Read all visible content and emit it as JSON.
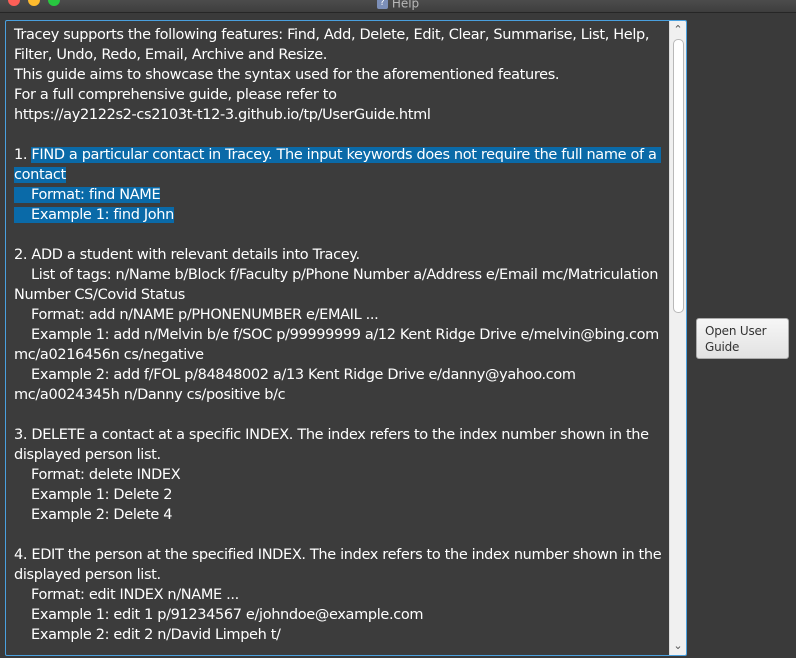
{
  "window": {
    "title": "Help",
    "app_icon": "?"
  },
  "guide": {
    "intro": "Tracey supports the following features: Find, Add, Delete, Edit, Clear, Summarise, List, Help, Filter, Undo, Redo, Email, Archive and Resize.\nThis guide aims to showcase the syntax used for the aforementioned features.\nFor a full comprehensive guide, please refer to\nhttps://ay2122s2-cs2103t-t12-3.github.io/tp/UserGuide.html\n\n1. ",
    "selected": "FIND a particular contact in Tracey. The input keywords does not require the full name of a contact\n    Format: find NAME\n    Example 1: find John",
    "rest": "\n\n2. ADD a student with relevant details into Tracey.\n    List of tags: n/Name b/Block f/Faculty p/Phone Number a/Address e/Email mc/Matriculation Number CS/Covid Status\n    Format: add n/NAME p/PHONENUMBER e/EMAIL ...\n    Example 1: add n/Melvin b/e f/SOC p/99999999 a/12 Kent Ridge Drive e/melvin@bing.com mc/a0216456n cs/negative\n    Example 2: add f/FOL p/84848002 a/13 Kent Ridge Drive e/danny@yahoo.com mc/a0024345h n/Danny cs/positive b/c\n\n3. DELETE a contact at a specific INDEX. The index refers to the index number shown in the displayed person list.\n    Format: delete INDEX\n    Example 1: Delete 2\n    Example 2: Delete 4\n\n4. EDIT the person at the specified INDEX. The index refers to the index number shown in the displayed person list.\n    Format: edit INDEX n/NAME ...\n    Example 1: edit 1 p/91234567 e/johndoe@example.com\n    Example 2: edit 2 n/David Limpeh t/"
  },
  "scrollbar": {
    "up_icon": "chevron-up-icon",
    "down_icon": "chevron-down-icon"
  },
  "buttons": {
    "open_user_guide": "Open User\nGuide"
  },
  "colors": {
    "background": "#3a3a3a",
    "text": "#ffffff",
    "selection": "#0a6aa8",
    "focus_border": "#4aa0de"
  }
}
